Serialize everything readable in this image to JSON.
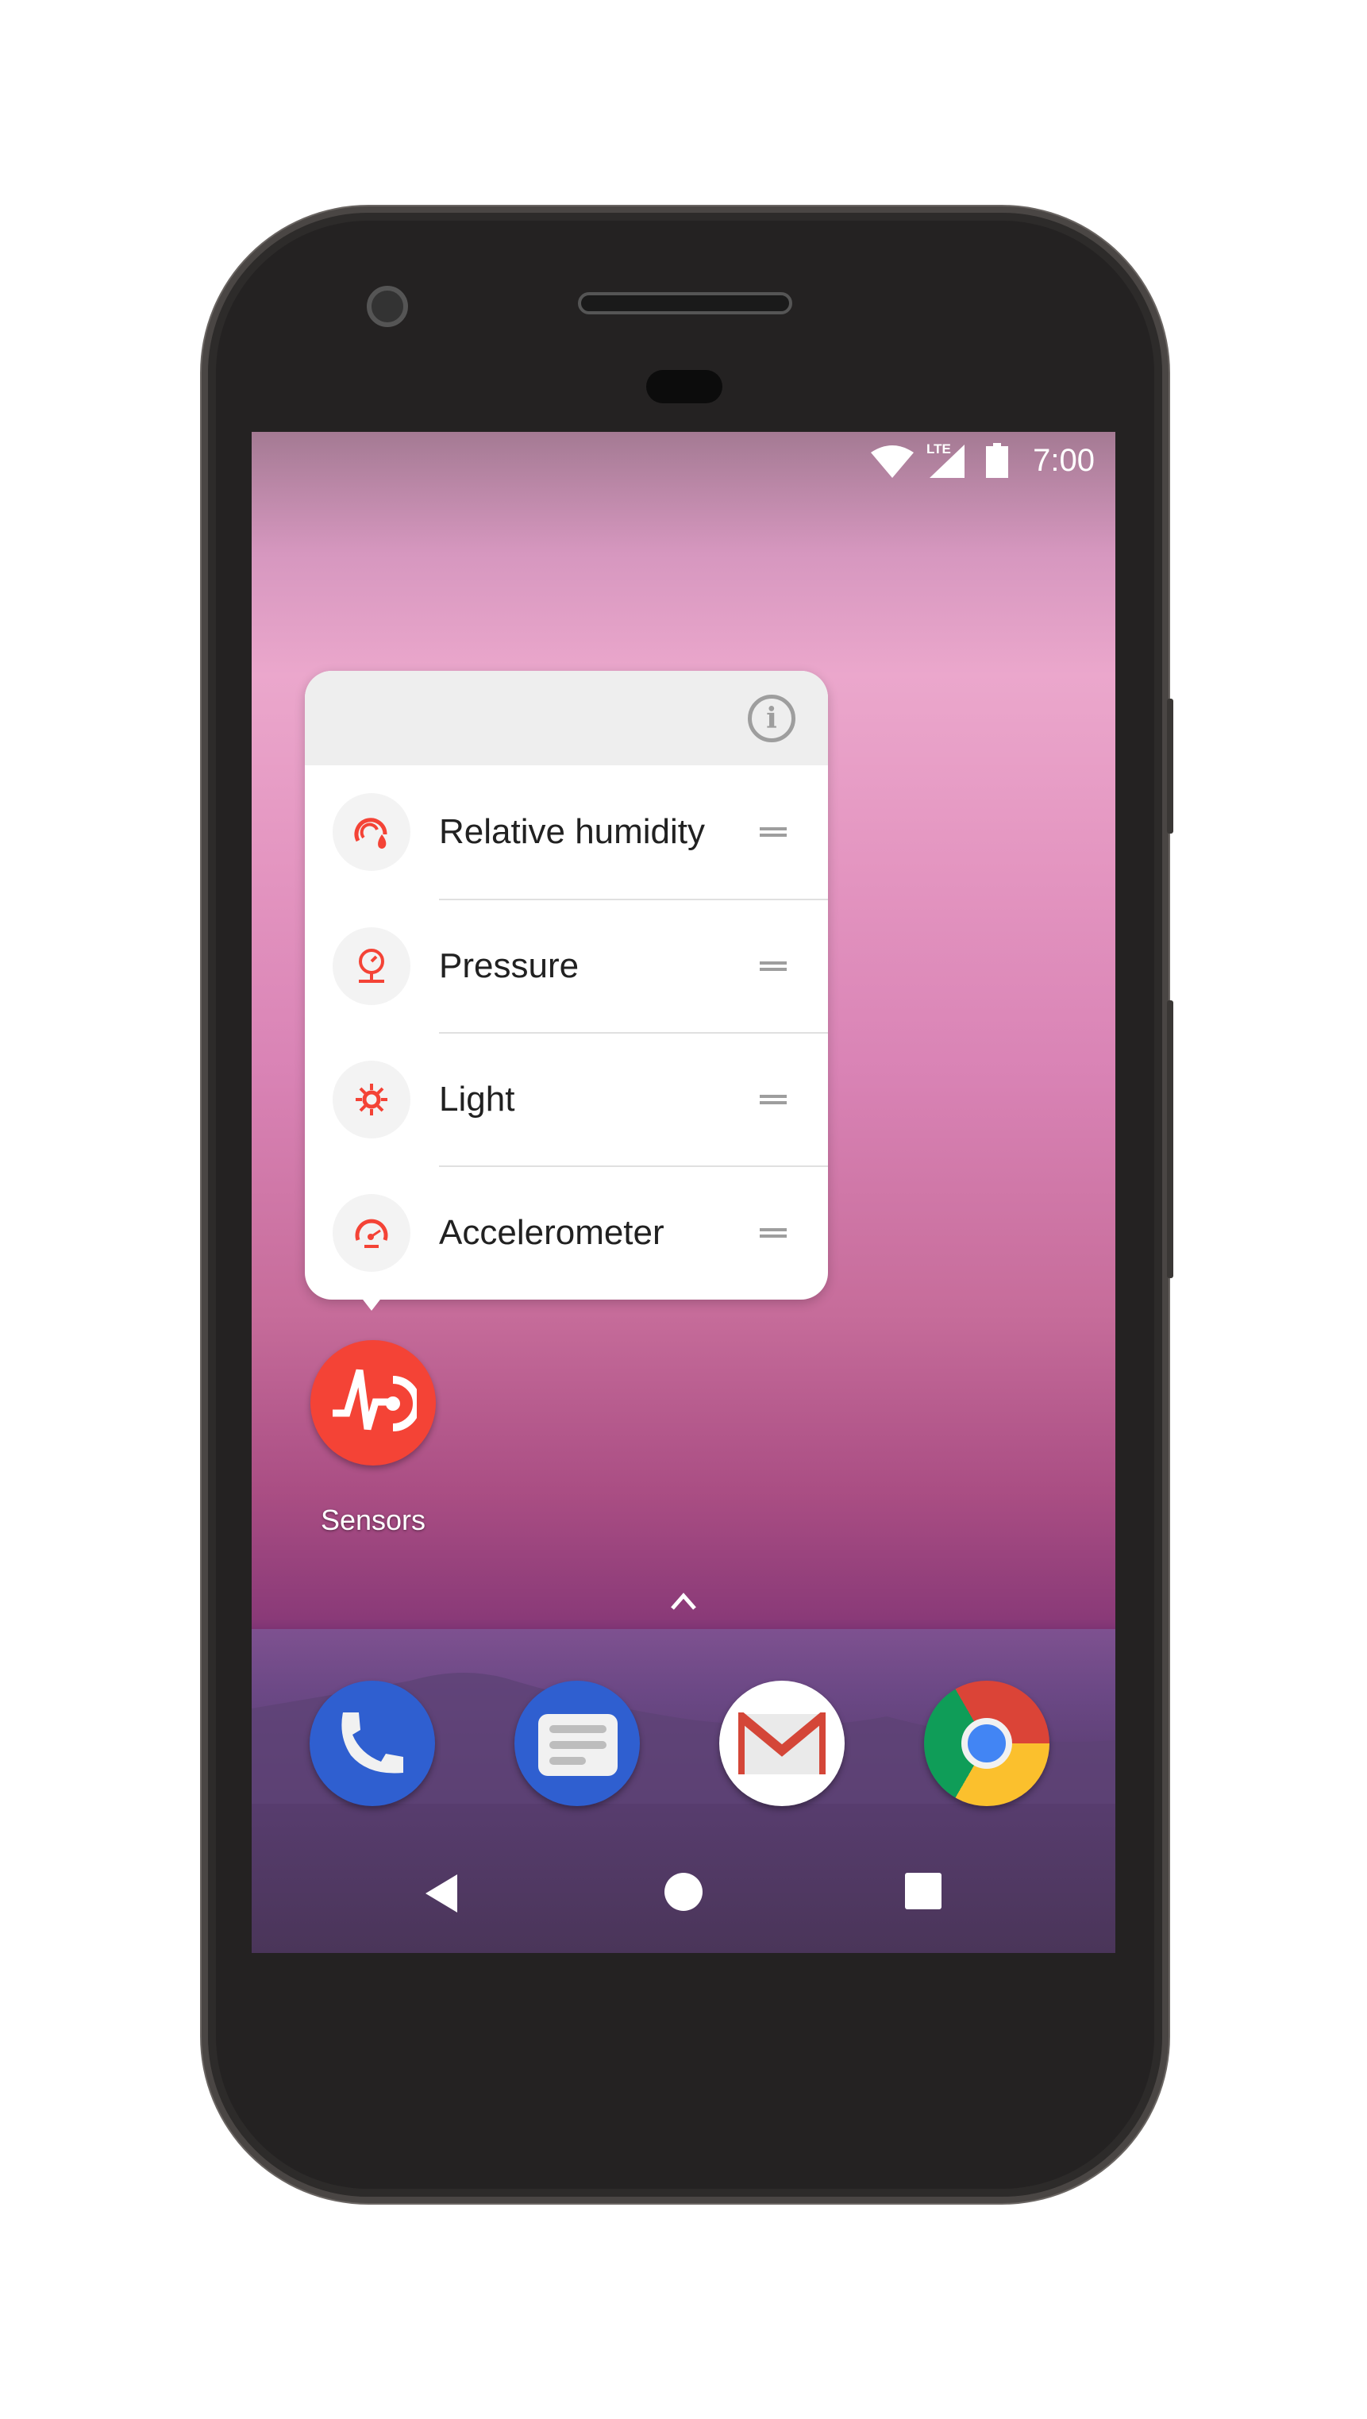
{
  "status_bar": {
    "time": "7:00",
    "network_label": "LTE",
    "icons": [
      "wifi-icon",
      "signal-icon",
      "battery-icon"
    ]
  },
  "shortcut_popup": {
    "info_icon": "info-icon",
    "items": [
      {
        "label": "Relative humidity",
        "icon": "humidity-gauge-icon"
      },
      {
        "label": "Pressure",
        "icon": "pressure-gauge-icon"
      },
      {
        "label": "Light",
        "icon": "sun-icon"
      },
      {
        "label": "Accelerometer",
        "icon": "speedometer-icon"
      }
    ]
  },
  "home": {
    "app_label": "Sensors",
    "accent": "#f44336"
  },
  "dock": {
    "apps": [
      "phone-icon",
      "messages-icon",
      "gmail-icon",
      "chrome-icon"
    ]
  },
  "nav_bar": {
    "buttons": [
      "back",
      "home",
      "recents"
    ]
  }
}
